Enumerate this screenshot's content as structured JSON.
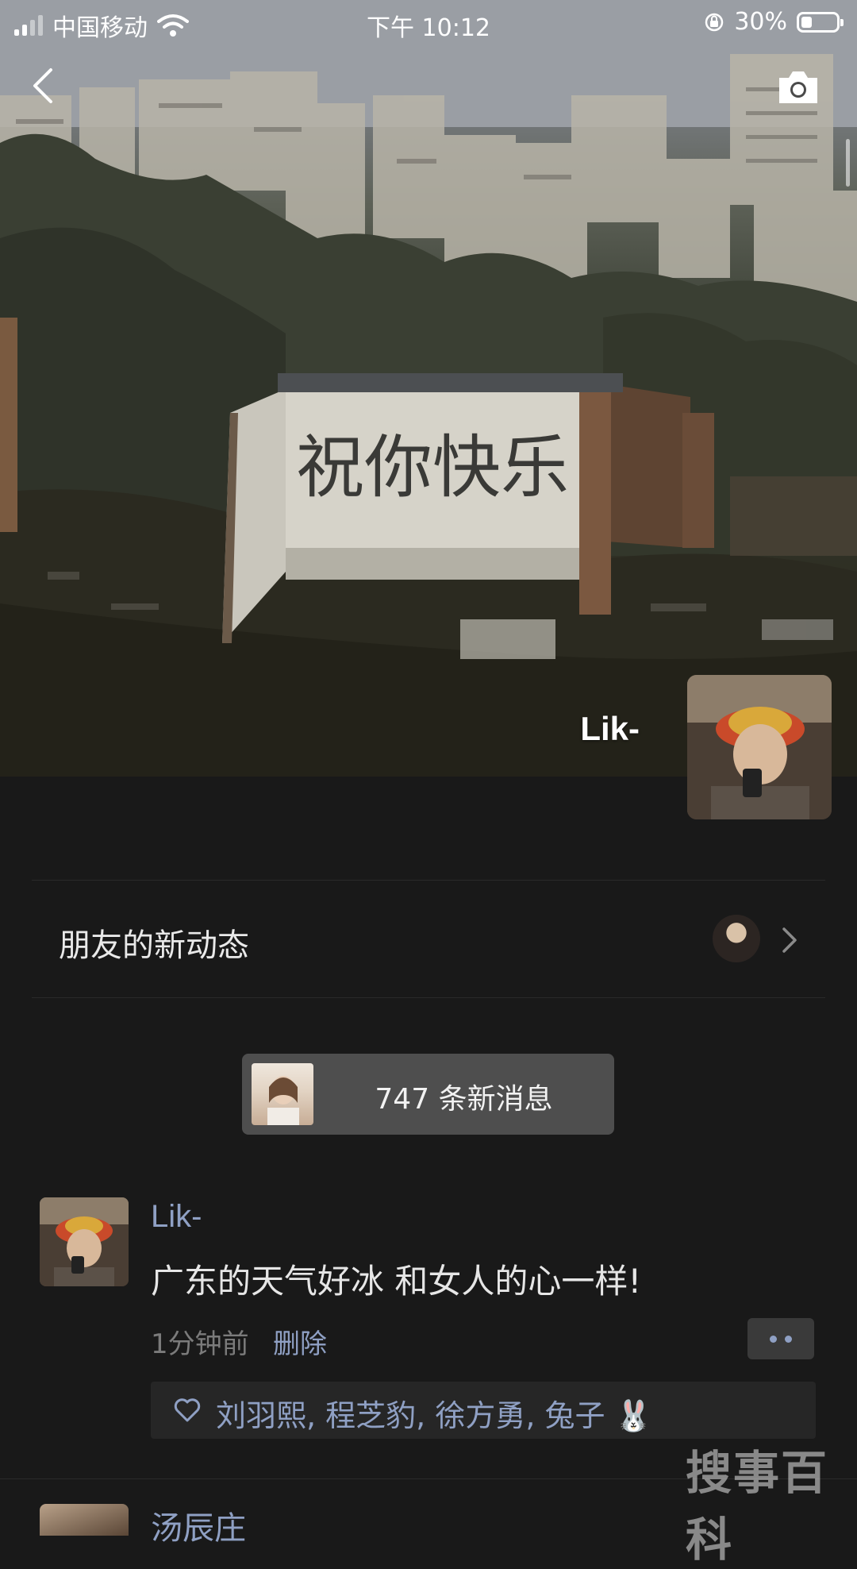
{
  "status_bar": {
    "carrier": "中国移动",
    "time": "下午 10:12",
    "battery": "30%",
    "battery_level": 0.3
  },
  "cover": {
    "wall_text": "祝你快乐",
    "user_name": "Lik-"
  },
  "friend_updates": {
    "label": "朋友的新动态"
  },
  "new_messages": {
    "label": "747 条新消息"
  },
  "post": {
    "author": "Lik-",
    "text": "广东的天气好冰 和女人的心一样!",
    "time": "1分钟前",
    "delete_label": "删除",
    "likes": "刘羽熙, 程芝豹, 徐方勇, 兔子 🐰"
  },
  "next_post": {
    "author": "汤辰庄"
  },
  "watermark": "搜事百科",
  "colors": {
    "background": "#191919",
    "link_blue": "#8fa0c4",
    "pill": "#4e4e4e"
  }
}
